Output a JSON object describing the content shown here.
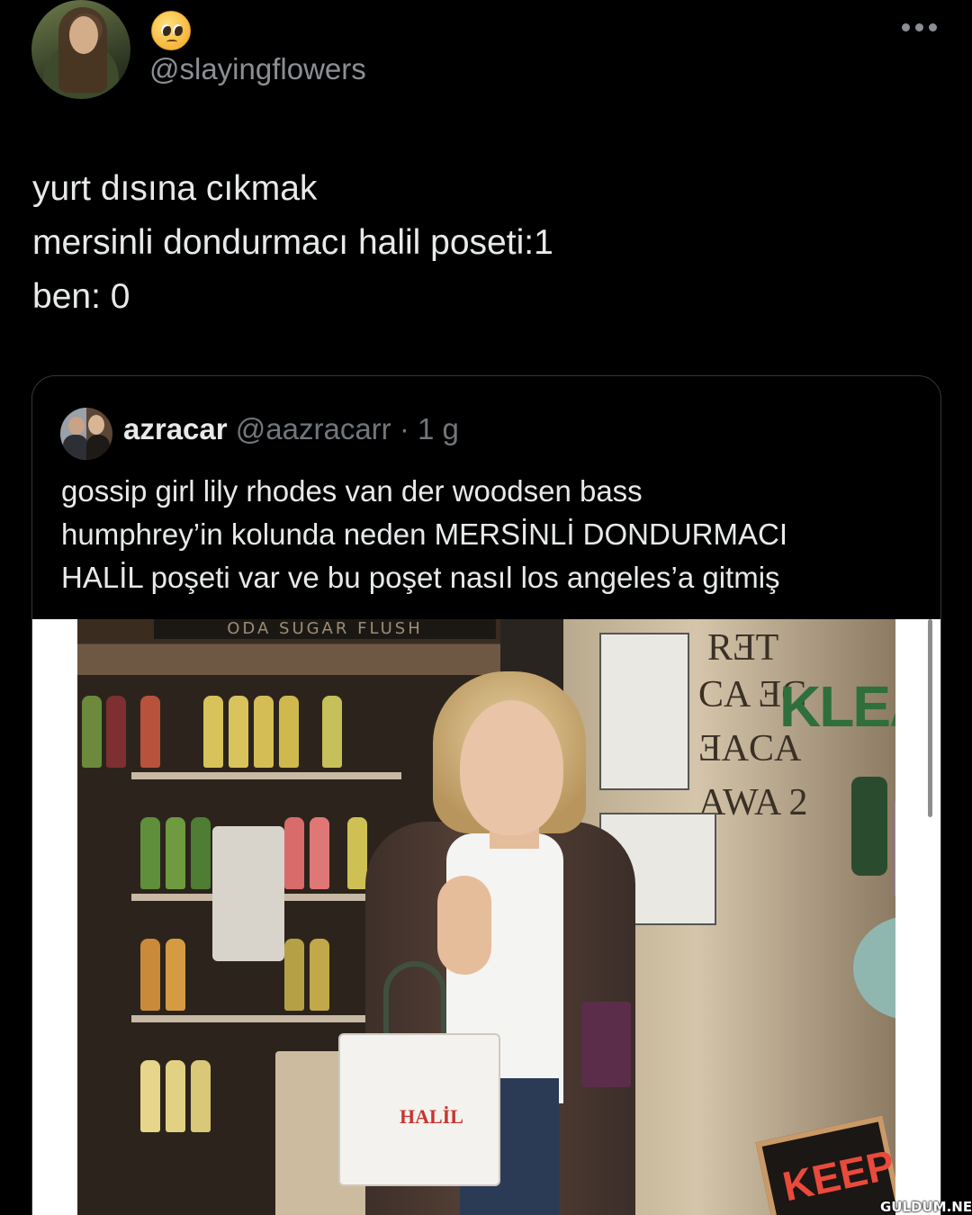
{
  "author": {
    "handle": "@slayingflowers",
    "display_emoji": "pleading-face"
  },
  "tweet": {
    "lines": [
      "yurt dısına cıkmak",
      "mersinli dondurmacı halil poseti:1",
      "ben: 0"
    ]
  },
  "quoted": {
    "name": "azracar",
    "handle": "@aazracarr",
    "time": "· 1 g",
    "lines": [
      "gossip girl lily rhodes van der woodsen bass",
      "humphrey’in kolunda neden MERSİNLİ DONDURMACI",
      "HALİL poşeti var ve bu poşet nasıl los angeles’a gitmiş"
    ]
  },
  "media": {
    "shelf_sign": "ODA SUGAR FLUSH",
    "storefront_text_1": "RƎT",
    "storefront_text_2": "CA ƎC",
    "storefront_text_3": "ƎACA",
    "storefront_text_4": "AWA 2",
    "storefront_brand": "KLEA",
    "bag_logo": "HALİL",
    "sign_text": "KEEP"
  },
  "watermark": "GULDUM.NET",
  "colors": {
    "background": "#000000",
    "text": "#e7e9ea",
    "muted": "#71767b",
    "card_border": "#333639"
  }
}
